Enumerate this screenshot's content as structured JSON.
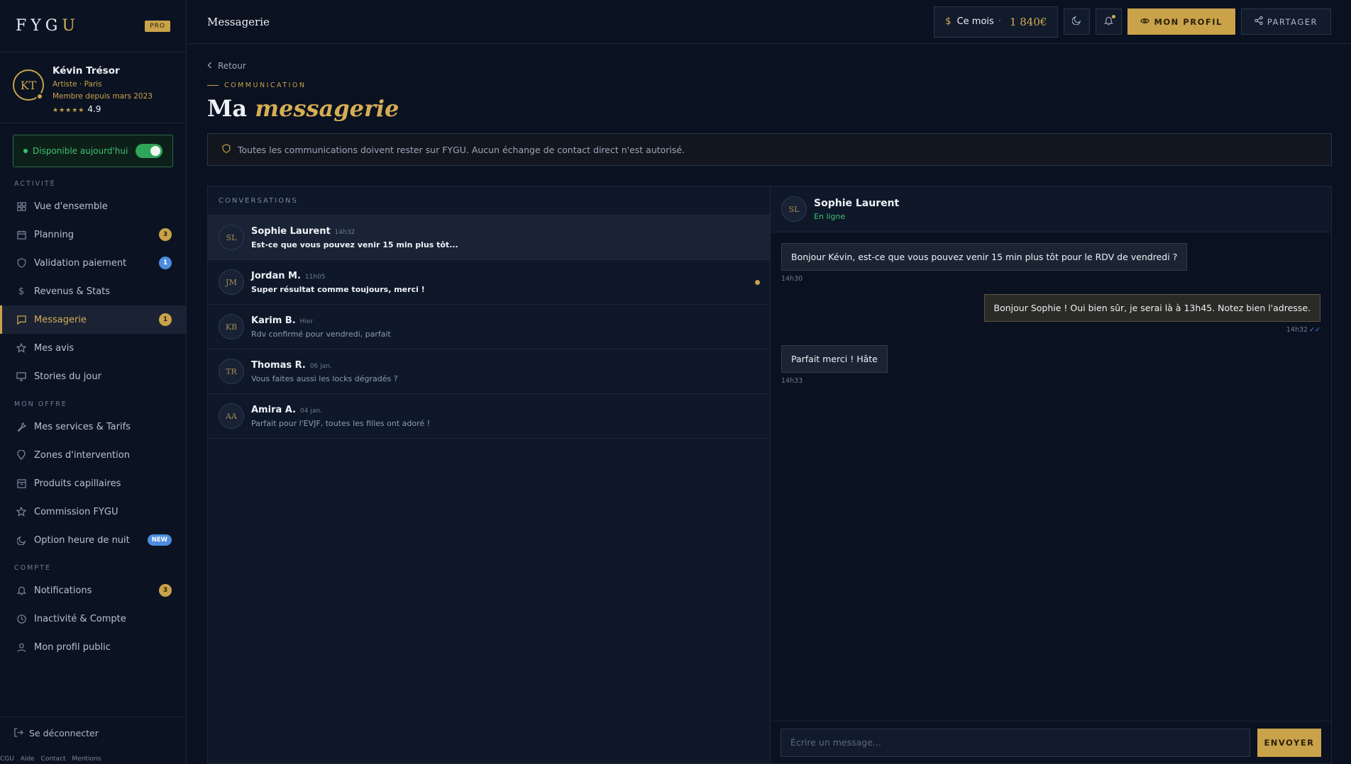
{
  "brand": {
    "logo_prefix": "FYG",
    "logo_suffix": "U",
    "plan_badge": "PRO"
  },
  "profile": {
    "initials": "KT",
    "name": "Kévin Trésor",
    "subtitle": "Artiste · Paris",
    "member_since": "Membre depuis mars 2023",
    "stars": "★★★★★",
    "rating": "4.9"
  },
  "availability": {
    "label": "Disponible aujourd'hui",
    "enabled": true
  },
  "sidebar": {
    "sections": [
      {
        "title": "ACTIVITÉ"
      },
      {
        "title": "MON OFFRE"
      },
      {
        "title": "COMPTE"
      }
    ],
    "activity": [
      {
        "label": "Vue d'ensemble",
        "icon": "grid-icon"
      },
      {
        "label": "Planning",
        "icon": "calendar-icon",
        "badge": "3"
      },
      {
        "label": "Validation paiement",
        "icon": "shield-icon",
        "badge": "1"
      },
      {
        "label": "Revenus & Stats",
        "icon": "dollar-icon"
      },
      {
        "label": "Messagerie",
        "icon": "message-icon",
        "badge": "1",
        "active": true
      },
      {
        "label": "Mes avis",
        "icon": "star-icon"
      },
      {
        "label": "Stories du jour",
        "icon": "monitor-icon"
      }
    ],
    "offer": [
      {
        "label": "Mes services & Tarifs",
        "icon": "wrench-icon"
      },
      {
        "label": "Zones d'intervention",
        "icon": "map-pin-icon"
      },
      {
        "label": "Produits capillaires",
        "icon": "package-icon"
      },
      {
        "label": "Commission FYGU",
        "icon": "star-icon"
      },
      {
        "label": "Option heure de nuit",
        "icon": "moon-icon",
        "badge": "NEW"
      }
    ],
    "account": [
      {
        "label": "Notifications",
        "icon": "bell-icon",
        "badge": "3"
      },
      {
        "label": "Inactivité & Compte",
        "icon": "clock-icon"
      },
      {
        "label": "Mon profil public",
        "icon": "user-icon"
      }
    ],
    "logout": "Se déconnecter",
    "footer": [
      "CGU",
      "Aide",
      "Contact",
      "Mentions"
    ]
  },
  "topbar": {
    "title": "Messagerie",
    "month_label": "Ce mois",
    "month_sep": "·",
    "month_amount": "1 840€",
    "profile_button": "MON PROFIL",
    "share_button": "PARTAGER"
  },
  "main": {
    "back": "Retour",
    "eyebrow": "COMMUNICATION",
    "title_plain": "Ma",
    "title_accent": "messagerie",
    "notice": "Toutes les communications doivent rester sur FYGU. Aucun échange de contact direct n'est autorisé."
  },
  "conversations": {
    "header": "CONVERSATIONS",
    "items": [
      {
        "initials": "SL",
        "name": "Sophie Laurent",
        "time": "14h32",
        "preview": "Est-ce que vous pouvez venir 15 min plus tôt...",
        "active": true,
        "unread": true
      },
      {
        "initials": "JM",
        "name": "Jordan M.",
        "time": "11h05",
        "preview": "Super résultat comme toujours, merci !",
        "unread": true,
        "dot": true
      },
      {
        "initials": "KB",
        "name": "Karim B.",
        "time": "Hier",
        "preview": "Rdv confirmé pour vendredi, parfait"
      },
      {
        "initials": "TR",
        "name": "Thomas R.",
        "time": "06 jan.",
        "preview": "Vous faites aussi les locks dégradés ?"
      },
      {
        "initials": "AA",
        "name": "Amira A.",
        "time": "04 jan.",
        "preview": "Parfait pour l'EVJF, toutes les filles ont adoré !"
      }
    ]
  },
  "chat": {
    "initials": "SL",
    "name": "Sophie Laurent",
    "status": "En ligne",
    "messages": [
      {
        "from": "in",
        "text": "Bonjour Kévin, est-ce que vous pouvez venir 15 min plus tôt pour le RDV de vendredi ?",
        "time": "14h30"
      },
      {
        "from": "out",
        "text": "Bonjour Sophie ! Oui bien sûr, je serai là à 13h45. Notez bien l'adresse.",
        "time": "14h32",
        "ticks": "✓✓"
      },
      {
        "from": "in",
        "text": "Parfait merci ! Hâte",
        "time": "14h33"
      }
    ],
    "composer_placeholder": "Écrire un message...",
    "send_button": "ENVOYER"
  }
}
